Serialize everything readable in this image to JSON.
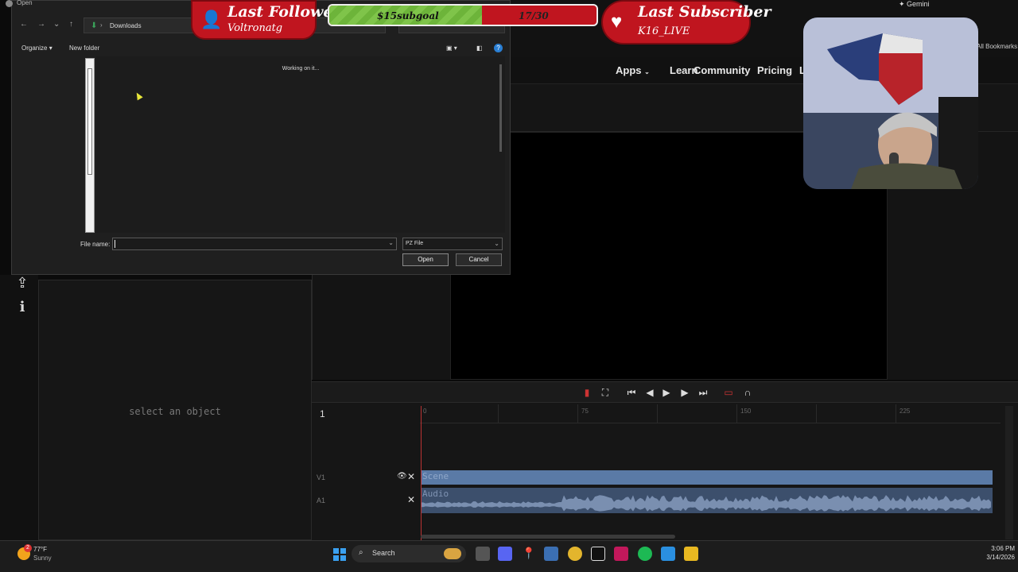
{
  "dialog": {
    "title": "Open",
    "path": "Downloads",
    "toolbar": {
      "organize": "Organize",
      "new_folder": "New folder"
    },
    "status": "Working on it...",
    "filename_label": "File name:",
    "filename_value": "",
    "filetype": "PZ File",
    "open_label": "Open",
    "cancel_label": "Cancel"
  },
  "overlay": {
    "follower_title": "Last Follower",
    "follower_name": "Voltronatg",
    "goal_label": "$15subgoal",
    "goal_count": "17/30",
    "goal_progress": 0.57,
    "subscriber_title": "Last Subscriber",
    "subscriber_name": "K16_LIVE"
  },
  "browser": {
    "gemini": "Gemini",
    "bookmarks": "All Bookmarks",
    "nav": {
      "apps": "Apps",
      "learn": "Learn",
      "community": "Community",
      "pricing": "Pricing",
      "extra": "L"
    }
  },
  "editor": {
    "empty_props": "select an object",
    "timeline_number": "1",
    "ruler": [
      "0",
      "75",
      "150",
      "225"
    ],
    "tracks": {
      "v1": "V1",
      "a1": "A1"
    },
    "clips": {
      "scene": "Scene",
      "audio": "Audio"
    }
  },
  "taskbar": {
    "temperature": "77°F",
    "condition": "Sunny",
    "weather_badge": "2",
    "search": "Search",
    "time": "3:06 PM",
    "date": "3/14/2026"
  },
  "colors": {
    "overlay_red": "#c0151f",
    "goal_green": "#7fc44a",
    "clip_blue": "#5a7aa6"
  }
}
